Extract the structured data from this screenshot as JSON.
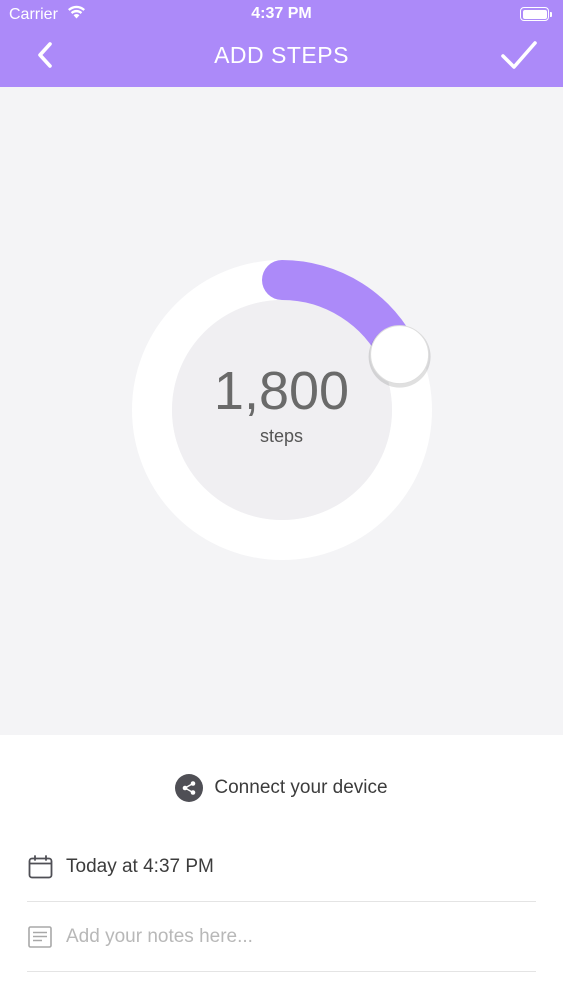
{
  "status_bar": {
    "carrier": "Carrier",
    "time": "4:37 PM",
    "wifi_icon": "wifi-icon",
    "battery_icon": "battery-icon"
  },
  "nav": {
    "title": "ADD STEPS",
    "back_icon": "chevron-left-icon",
    "confirm_icon": "checkmark-icon"
  },
  "dial": {
    "value": "1,800",
    "unit": "steps",
    "progress_fraction": 0.18
  },
  "connect": {
    "label": "Connect your device",
    "icon": "share-icon"
  },
  "date_row": {
    "label": "Today at 4:37 PM",
    "icon": "calendar-icon"
  },
  "notes_row": {
    "placeholder": "Add your notes here...",
    "value": "",
    "icon": "notes-icon"
  },
  "colors": {
    "accent": "#ac8af9",
    "header": "#ac8af9",
    "dial_background": "#f4f4f6",
    "ring": "#ffffff",
    "text": "#3c3c3c"
  }
}
